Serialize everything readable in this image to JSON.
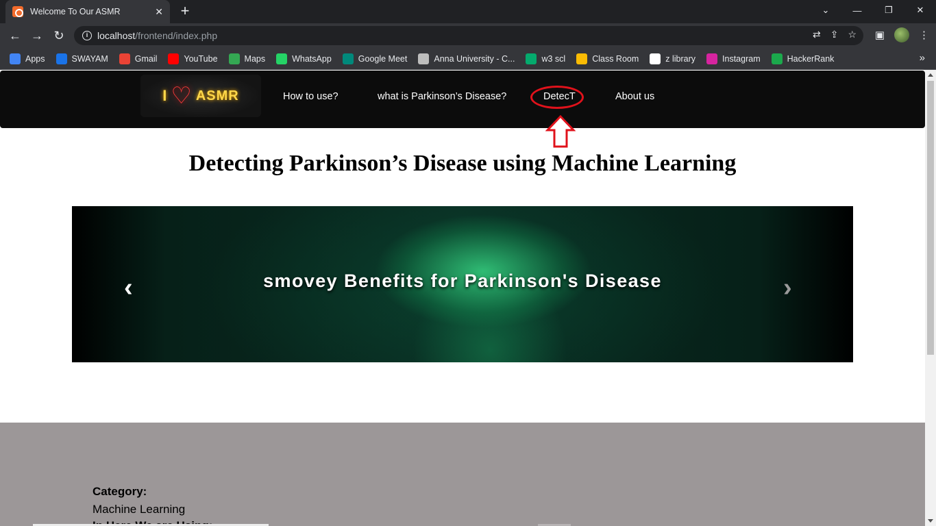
{
  "browser": {
    "tab_title": "Welcome To Our ASMR",
    "url_host": "localhost",
    "url_path": "/frontend/index.php",
    "bookmarks": [
      {
        "label": "Apps",
        "icon": "apps-grid-icon",
        "color": "#4285f4"
      },
      {
        "label": "SWAYAM",
        "icon": "swayam-icon",
        "color": "#1a73e8"
      },
      {
        "label": "Gmail",
        "icon": "gmail-icon",
        "color": "#ea4335"
      },
      {
        "label": "YouTube",
        "icon": "youtube-icon",
        "color": "#ff0000"
      },
      {
        "label": "Maps",
        "icon": "maps-icon",
        "color": "#34a853"
      },
      {
        "label": "WhatsApp",
        "icon": "whatsapp-icon",
        "color": "#25d366"
      },
      {
        "label": "Google Meet",
        "icon": "google-meet-icon",
        "color": "#00897b"
      },
      {
        "label": "Anna University - C...",
        "icon": "anna-university-icon",
        "color": "#bdbdbd"
      },
      {
        "label": "w3 scl",
        "icon": "w3schools-icon",
        "color": "#04aa6d"
      },
      {
        "label": "Class Room",
        "icon": "classroom-icon",
        "color": "#fbbc04"
      },
      {
        "label": "z library",
        "icon": "zlibrary-icon",
        "color": "#ffffff"
      },
      {
        "label": "Instagram",
        "icon": "instagram-icon",
        "color": "#d6249f"
      },
      {
        "label": "HackerRank",
        "icon": "hackerrank-icon",
        "color": "#1ba94c"
      }
    ]
  },
  "site": {
    "logo": {
      "i": "I",
      "text": "ASMR"
    },
    "nav": [
      "How to use?",
      "what is Parkinson’s Disease?",
      "DetecT",
      "About us"
    ],
    "heading": "Detecting Parkinson’s Disease using Machine Learning",
    "carousel_caption": "smovey Benefits for Parkinson's Disease",
    "footer": {
      "category_label": "Category:",
      "category_value": "Machine Learning",
      "using_label": "In Here We are Using:"
    }
  },
  "colors": {
    "highlight": "#e0121b",
    "nav_bg": "#0c0c0c",
    "footer_bg": "#9c9798"
  }
}
